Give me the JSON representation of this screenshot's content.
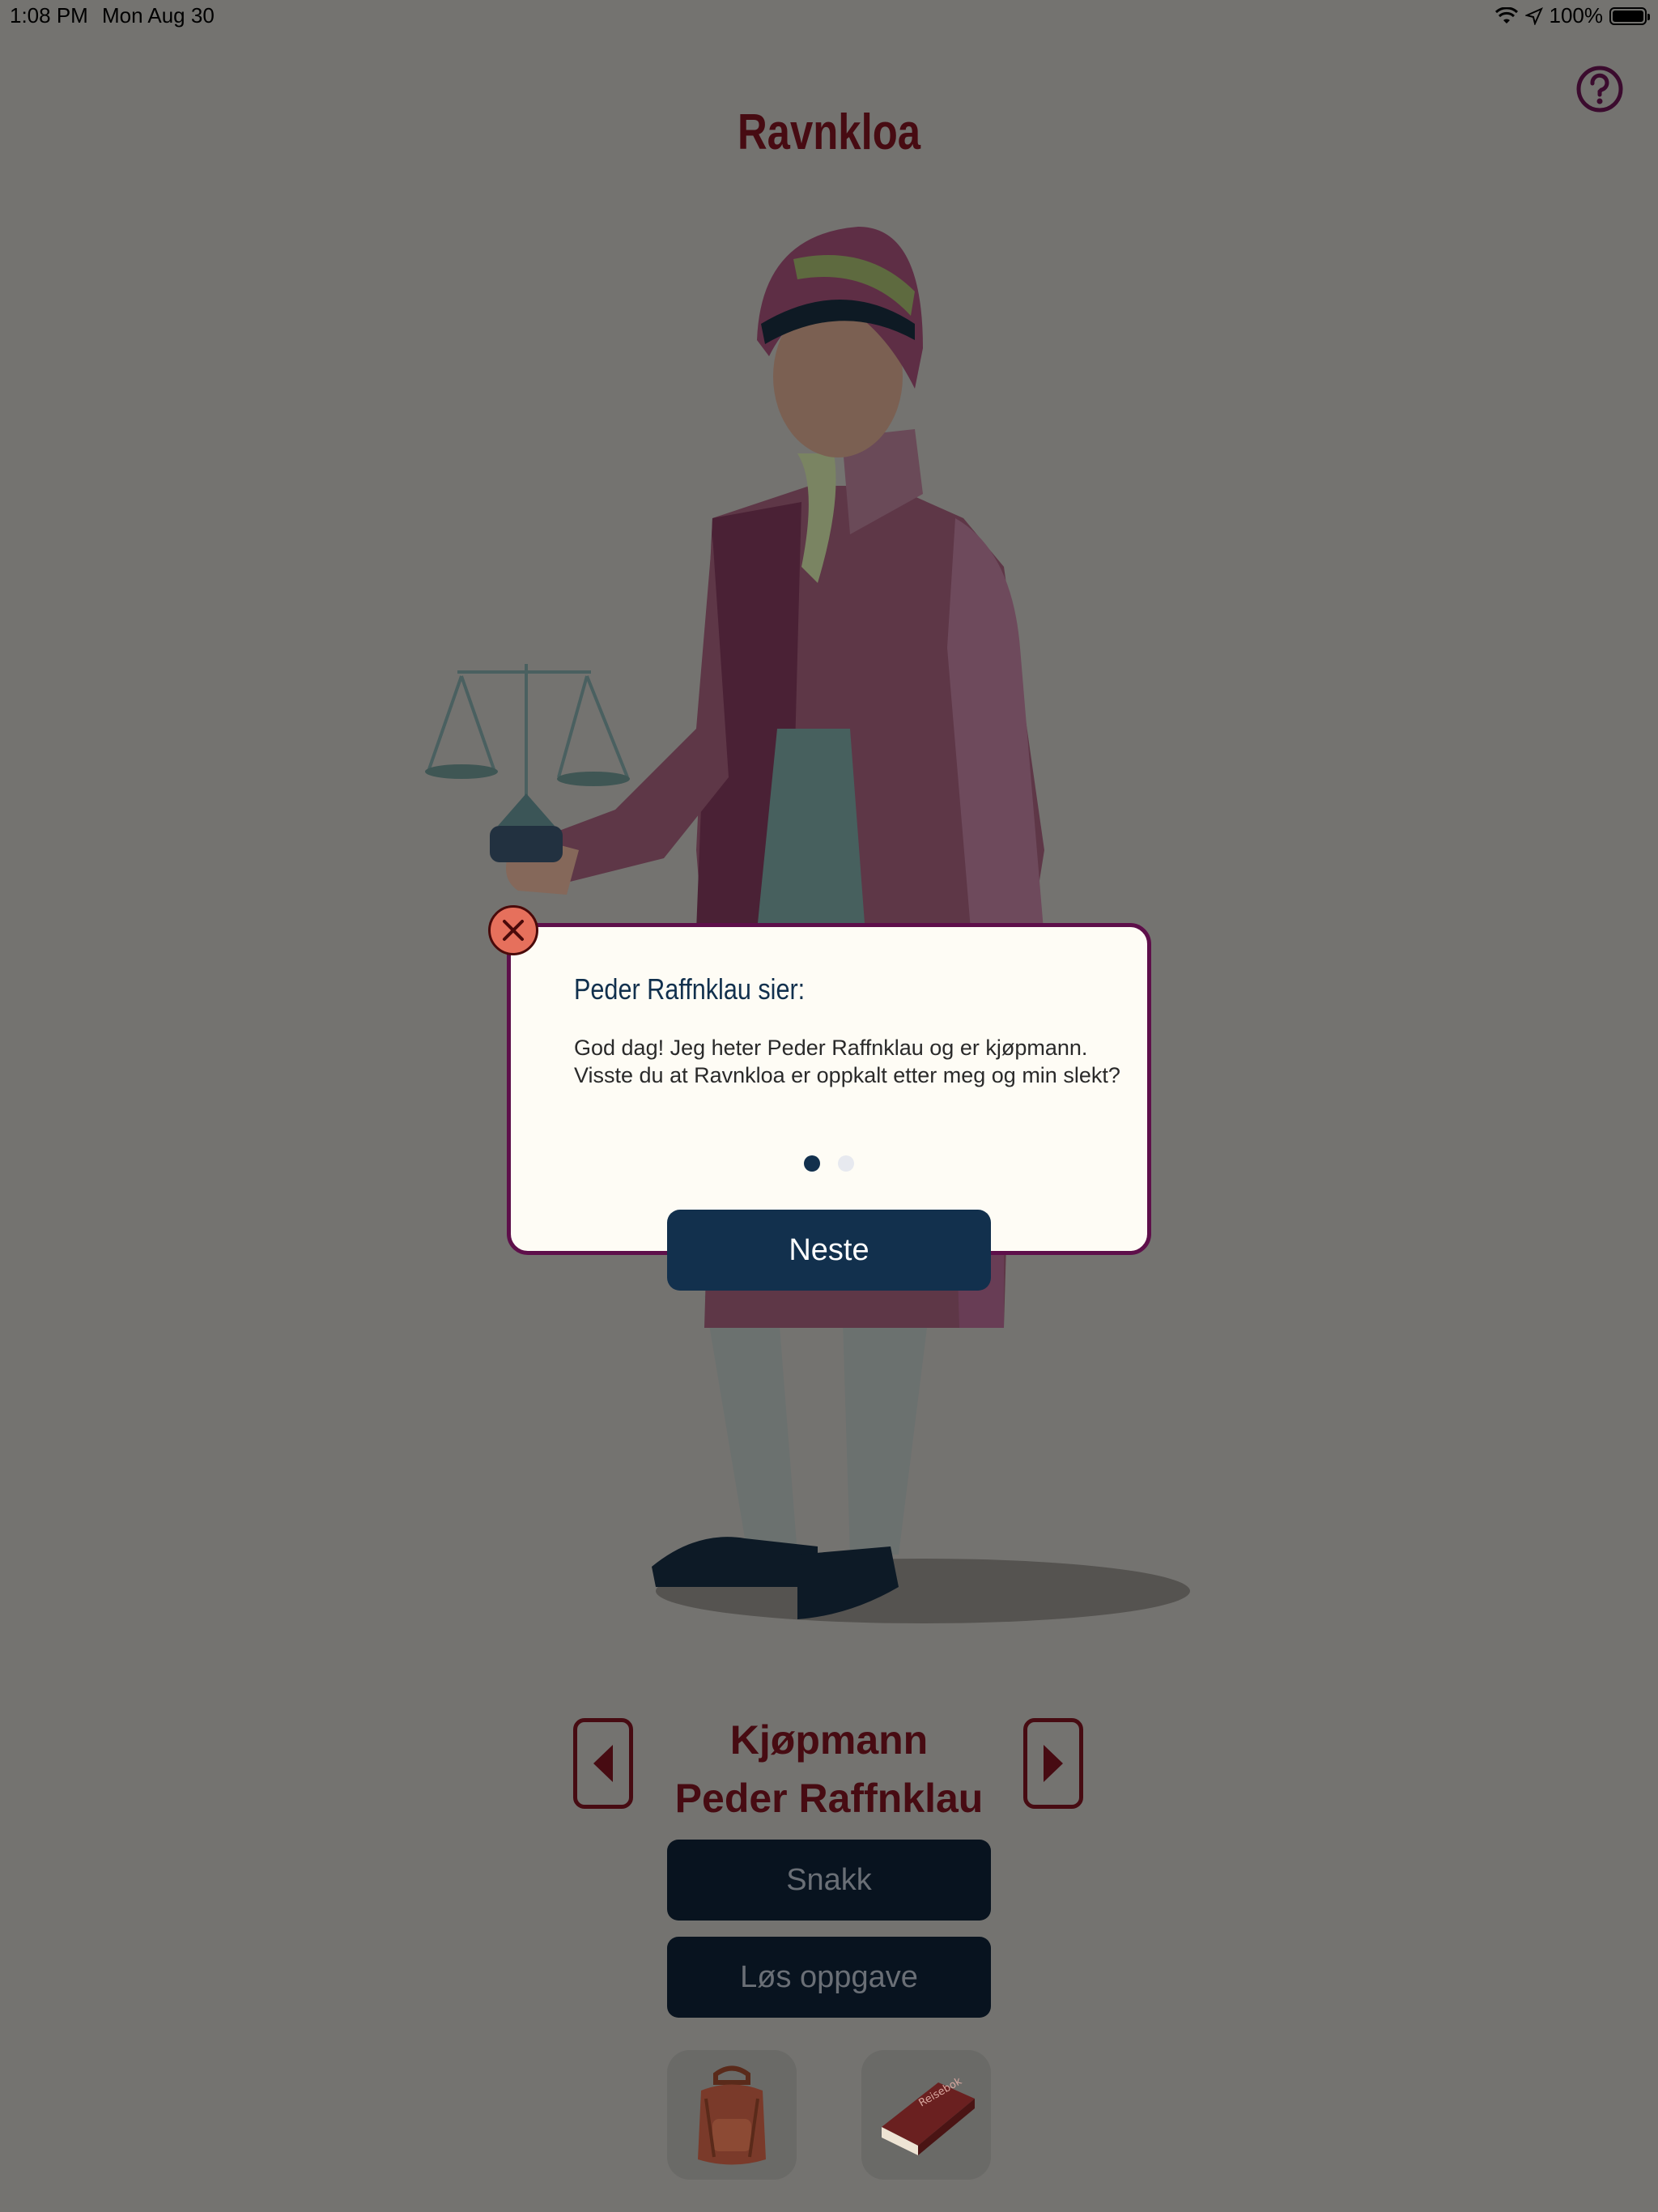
{
  "status_bar": {
    "time": "1:08 PM",
    "date": "Mon Aug 30",
    "battery": "100%",
    "icons": [
      "wifi-icon",
      "location-arrow-icon",
      "battery-icon"
    ]
  },
  "header": {
    "title": "Ravnkloa",
    "help_icon": "question-circle-icon"
  },
  "dialog": {
    "speaker": "Peder Raffnklau sier:",
    "message": "God dag! Jeg heter Peder Raffnklau og er kjøpmann. Visste du at Ravnkloa er oppkalt etter meg og min slekt?",
    "page": 1,
    "page_count": 2,
    "next_label": "Neste",
    "close_icon": "close-icon"
  },
  "character": {
    "role": "Kjøpmann",
    "name": "Peder Raffnklau",
    "prev_icon": "arrow-left-icon",
    "next_icon": "arrow-right-icon"
  },
  "actions": {
    "talk_label": "Snakk",
    "task_label": "Løs oppgave"
  },
  "toolbar": {
    "backpack_icon": "backpack-icon",
    "book_icon": "travel-book-icon",
    "book_text": "Reisebok"
  },
  "colors": {
    "background": "#747370",
    "title": "#470b12",
    "primary_button": "#12304d",
    "dialog_border": "#5e0f4a",
    "close_button": "#e6705c"
  }
}
